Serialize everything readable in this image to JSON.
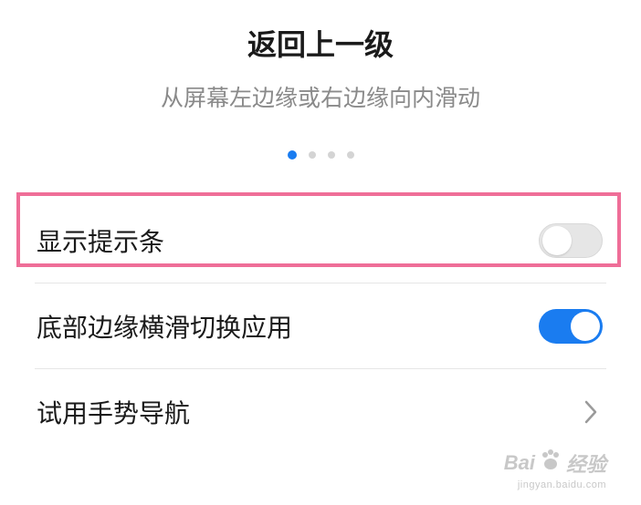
{
  "header": {
    "title": "返回上一级",
    "subtitle": "从屏幕左边缘或右边缘向内滑动"
  },
  "pagination": {
    "total": 4,
    "active_index": 0,
    "active_color": "#1a7cf0"
  },
  "settings": {
    "items": [
      {
        "label": "显示提示条",
        "control": "toggle",
        "enabled": false
      },
      {
        "label": "底部边缘横滑切换应用",
        "control": "toggle",
        "enabled": true
      },
      {
        "label": "试用手势导航",
        "control": "chevron",
        "icon": "chevron-right-icon"
      }
    ]
  },
  "highlight_color": "#ef6e98",
  "watermark": {
    "brand": "Bai",
    "brand_suffix": "经验",
    "url": "jingyan.baidu.com"
  }
}
